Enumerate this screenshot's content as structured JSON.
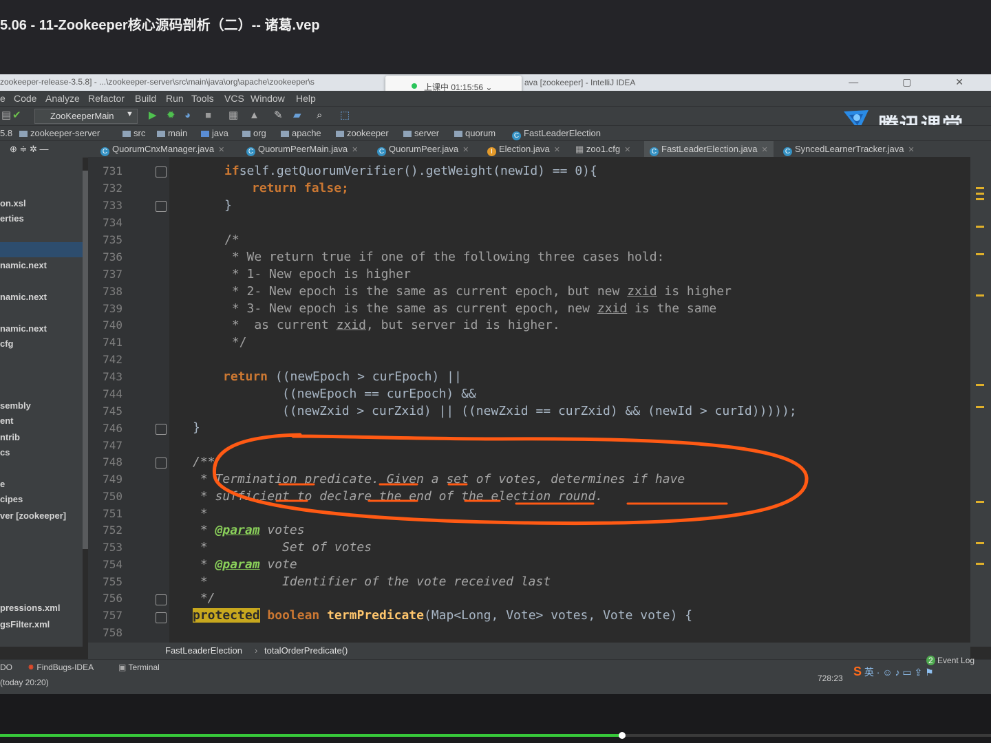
{
  "player": {
    "title": "5.06 - 11-Zookeeper核心源码剖析（二）-- 诸葛.vep"
  },
  "window": {
    "path": "zookeeper-release-3.5.8] - ...\\zookeeper-server\\src\\main\\java\\org\\apache\\zookeeper\\s",
    "app": "ava [zookeeper] - IntelliJ IDEA",
    "recording": "上课中 01:15:56",
    "rec_caret": "⌄",
    "controls": "— ▢ ✕"
  },
  "menu": [
    "e",
    "Code",
    "Analyze",
    "Refactor",
    "Build",
    "Run",
    "Tools",
    "VCS",
    "Window",
    "Help"
  ],
  "toolbar": {
    "run_config": "ZooKeeperMain"
  },
  "brand": {
    "name": "腾讯课堂",
    "color": "#2a8be6"
  },
  "nav": [
    "5.8",
    "zookeeper-server",
    "src",
    "main",
    "java",
    "org",
    "apache",
    "zookeeper",
    "server",
    "quorum",
    "FastLeaderElection"
  ],
  "tabs": [
    {
      "label": "QuorumCnxManager.java",
      "icon": "class-icon"
    },
    {
      "label": "QuorumPeerMain.java",
      "icon": "class-icon"
    },
    {
      "label": "QuorumPeer.java",
      "icon": "class-icon"
    },
    {
      "label": "Election.java",
      "icon": "interface-icon"
    },
    {
      "label": "zoo1.cfg",
      "icon": "config-icon"
    },
    {
      "label": "FastLeaderElection.java",
      "icon": "class-icon",
      "active": true
    },
    {
      "label": "SyncedLearnerTracker.java",
      "icon": "class-icon"
    }
  ],
  "sidebar": [
    "on.xsl",
    "erties",
    "namic.next",
    "namic.next",
    "namic.next",
    "cfg",
    "sembly",
    "ent",
    "ntrib",
    "cs",
    "e",
    "cipes",
    "ver [zookeeper]",
    "pressions.xml",
    "gsFilter.xml"
  ],
  "line_numbers": [
    "731",
    "732",
    "733",
    "734",
    "735",
    "736",
    "737",
    "738",
    "739",
    "740",
    "741",
    "742",
    "743",
    "744",
    "745",
    "746",
    "747",
    "748",
    "749",
    "750",
    "751",
    "752",
    "753",
    "754",
    "755",
    "756",
    "757",
    "758"
  ],
  "code": {
    "l731": "self.getQuorumVerifier().getWeight(newId) == 0){",
    "l732": "false;",
    "l735": "/*",
    "l736": " * We return true if one of the following three cases hold:",
    "l737": " * 1- New epoch is higher",
    "l738a": " * 2- New epoch is the same as current epoch, but new ",
    "l738b": "zxid",
    "l738c": " is higher",
    "l739a": " * 3- New epoch is the same as current epoch, new ",
    "l739b": "zxid",
    "l739c": " is the same",
    "l740a": " *  as current ",
    "l740b": "zxid",
    "l740c": ", but server id is higher.",
    "l741": " */",
    "l743": " ((newEpoch > curEpoch) ||",
    "l744": "((newEpoch == curEpoch) &&",
    "l745": "((newZxid > curZxid) || ((newZxid == curZxid) && (newId > curId)))));",
    "l746": "}",
    "l748": "/**",
    "l749": " * Termination predicate. Given a set of votes, determines if have",
    "l750": " * sufficient to declare the end of the election round.",
    "l751": " *",
    "l752tag": "@param",
    "l752": " votes",
    "l753": " *          Set of votes",
    "l754tag": "@param",
    "l754": " vote",
    "l755": " *          Identifier of the vote received last",
    "l756": " */",
    "l757name": "termPredicate",
    "l757": "(Map<Long, Vote> votes, Vote vote) {",
    "kw_if": "if",
    "kw_return": "return",
    "kw_protected": "protected",
    "kw_boolean": "boolean",
    "star": " *",
    "brace": "}"
  },
  "bottom_breadcrumb": [
    "FastLeaderElection",
    "totalOrderPredicate()"
  ],
  "status": {
    "todo": "DO",
    "findbugs": "FindBugs-IDEA",
    "terminal": "Terminal",
    "event_log": "Event Log",
    "event_count": "2",
    "position": "728:23",
    "last": "(today 20:20)",
    "ime": "英"
  },
  "colors": {
    "annotation": "#ff5a14",
    "keyword": "#cc7832",
    "progress": "#37c83a"
  }
}
